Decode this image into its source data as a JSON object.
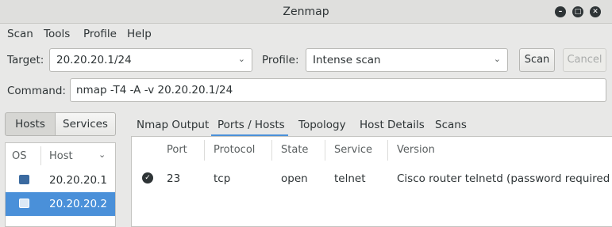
{
  "window": {
    "title": "Zenmap"
  },
  "menu": [
    "Scan",
    "Tools",
    "Profile",
    "Help"
  ],
  "target": {
    "label": "Target:",
    "value": "20.20.20.1/24"
  },
  "profile": {
    "label": "Profile:",
    "value": "Intense scan"
  },
  "buttons": {
    "scan": "Scan",
    "cancel": "Cancel"
  },
  "command": {
    "label": "Command:",
    "value": "nmap -T4 -A -v 20.20.20.1/24"
  },
  "left_tabs": {
    "hosts": "Hosts",
    "services": "Services"
  },
  "host_list": {
    "headers": {
      "os": "OS",
      "host": "Host"
    },
    "hosts": [
      "20.20.20.1",
      "20.20.20.2"
    ],
    "selected_index": 1
  },
  "tabs": [
    "Nmap Output",
    "Ports / Hosts",
    "Topology",
    "Host Details",
    "Scans"
  ],
  "active_tab": "Ports / Hosts",
  "ports_table": {
    "headers": [
      "Port",
      "Protocol",
      "State",
      "Service",
      "Version"
    ],
    "rows": [
      {
        "port": "23",
        "protocol": "tcp",
        "state": "open",
        "service": "telnet",
        "version": "Cisco router telnetd (password required"
      }
    ]
  },
  "colors": {
    "selection": "#4a90d9",
    "accent_underline": "#4a90d9"
  }
}
